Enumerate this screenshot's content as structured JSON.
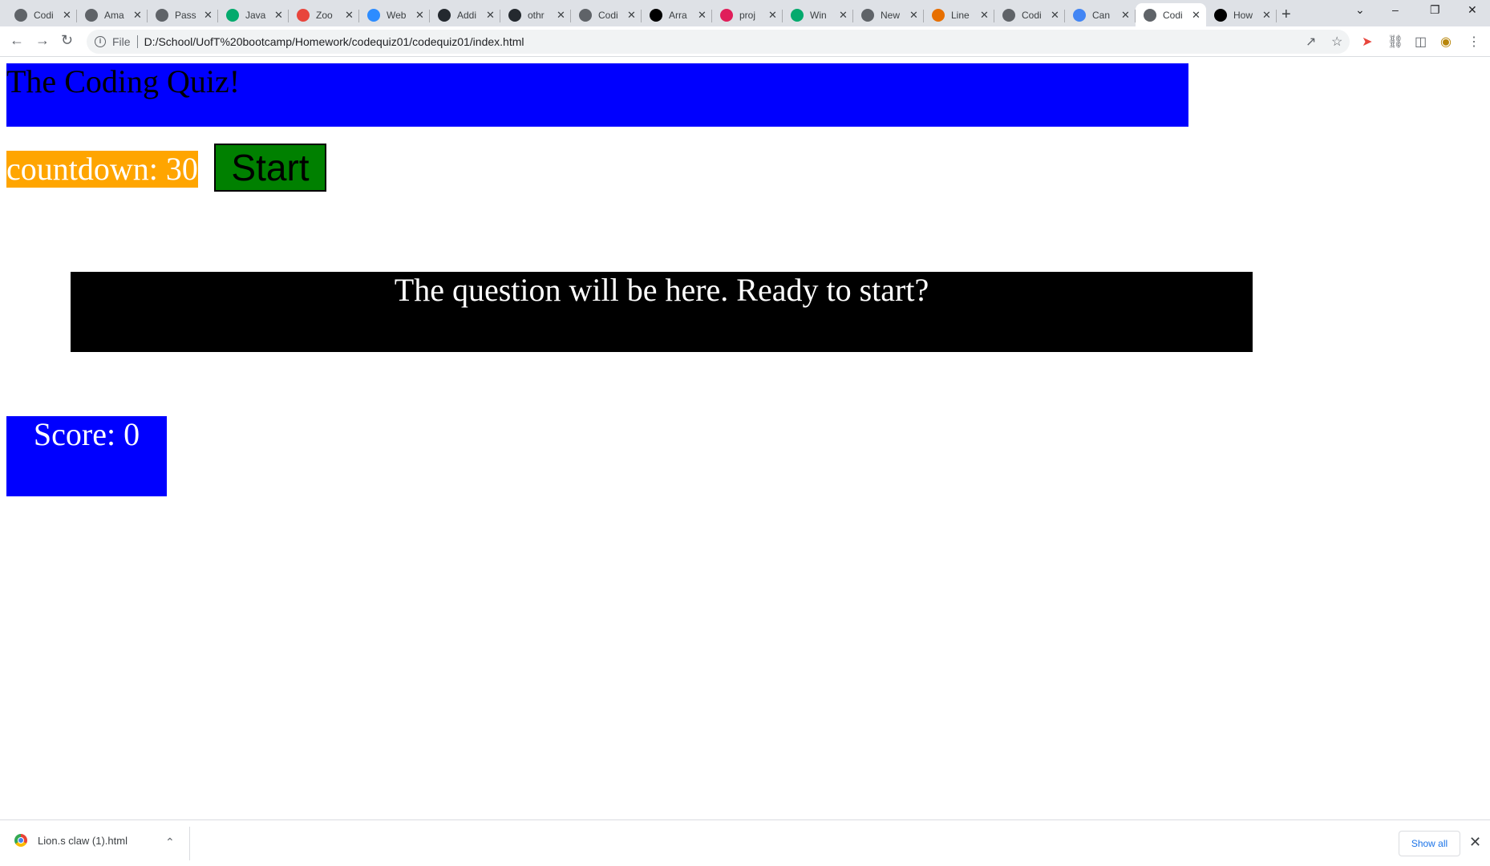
{
  "browser": {
    "tabs": [
      {
        "title": "Codi",
        "icon": "globe-icon",
        "color": "#5f6368"
      },
      {
        "title": "Ama",
        "icon": "globe-icon",
        "color": "#5f6368"
      },
      {
        "title": "Pass",
        "icon": "globe-icon",
        "color": "#5f6368"
      },
      {
        "title": "Java",
        "icon": "w3schools-icon",
        "color": "#04aa6d"
      },
      {
        "title": "Zoo",
        "icon": "circle-icon",
        "color": "#e8453c"
      },
      {
        "title": "Web",
        "icon": "zoom-icon",
        "color": "#2d8cff"
      },
      {
        "title": "Addi",
        "icon": "github-icon",
        "color": "#24292f"
      },
      {
        "title": "othr",
        "icon": "github-icon",
        "color": "#24292f"
      },
      {
        "title": "Codi",
        "icon": "globe-icon",
        "color": "#5f6368"
      },
      {
        "title": "Arra",
        "icon": "mdn-icon",
        "color": "#000000"
      },
      {
        "title": "proj",
        "icon": "slack-icon",
        "color": "#e01e5a"
      },
      {
        "title": "Win",
        "icon": "w3schools-icon",
        "color": "#04aa6d"
      },
      {
        "title": "New",
        "icon": "globe-icon",
        "color": "#5f6368"
      },
      {
        "title": "Line",
        "icon": "java-icon",
        "color": "#e76f00"
      },
      {
        "title": "Codi",
        "icon": "globe-icon",
        "color": "#5f6368"
      },
      {
        "title": "Can",
        "icon": "google-icon",
        "color": "#4285f4"
      },
      {
        "title": "Codi",
        "icon": "globe-icon",
        "color": "#5f6368",
        "active": true
      },
      {
        "title": "How",
        "icon": "mdn-icon",
        "color": "#000000"
      }
    ],
    "address": {
      "scheme": "File",
      "url": "D:/School/UofT%20bootcamp/Homework/codequiz01/codequiz01/index.html"
    }
  },
  "page": {
    "header_title": "The Coding Quiz!",
    "countdown_text": "countdown: 30",
    "start_button_label": "Start",
    "question_text": "The question will be here. Ready to start?",
    "score_text": "Score: 0"
  },
  "downloads": {
    "file_name": "Lion.s claw (1).html",
    "show_all_label": "Show all"
  },
  "colors": {
    "header_bg": "#0000ff",
    "countdown_bg": "#ffa500",
    "start_bg": "#008000",
    "question_bg": "#000000",
    "score_bg": "#0000ff"
  }
}
